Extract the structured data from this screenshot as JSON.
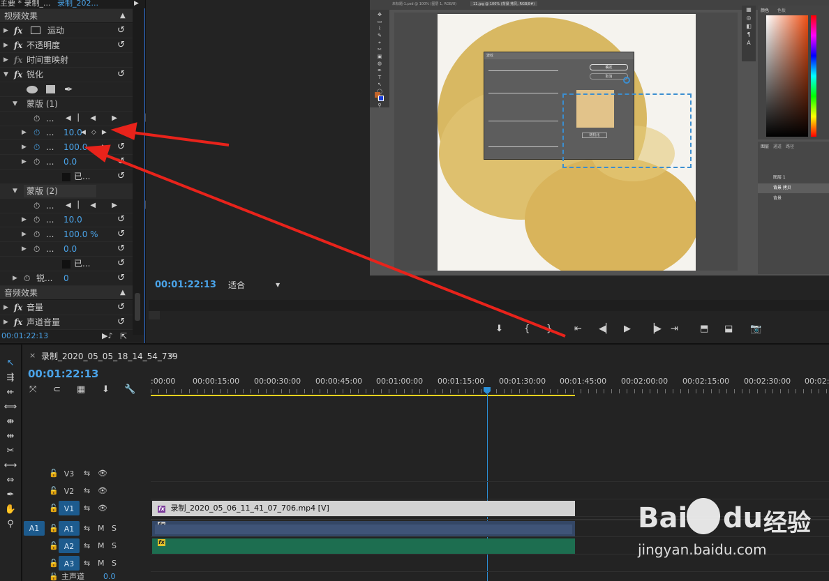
{
  "effect_controls": {
    "header": [
      "主要 * 录制_...",
      "录制_202..."
    ],
    "video_effects": "视频效果",
    "motion": "运动",
    "opacity": "不透明度",
    "time_remap": "时间重映射",
    "sharpen": "锐化",
    "mask1": "蒙版 (1)",
    "mask2": "蒙版 (2)",
    "ellipsis": "...",
    "mask1_values": [
      "10.0",
      "100.0",
      "0.0"
    ],
    "mask2_values": [
      "10.0",
      "100.0 %",
      "0.0"
    ],
    "inverted": "已...",
    "sharpen_param": "锐...",
    "sharpen_value": "0",
    "audio_effects": "音频效果",
    "volume": "音量",
    "channel_volume": "声道音量",
    "timecode": "00:01:22:13"
  },
  "program_monitor": {
    "timecode": "00:01:22:13",
    "fit": "适合"
  },
  "photoshop": {
    "tabs": [
      "未标题-1.psd @ 100% (图层 1, RGB/8)",
      "11.jpg @ 100% (背景 拷贝, RGB/8#)"
    ],
    "dialog_title": "波纹",
    "ok": "确定",
    "cancel": "取消",
    "randomize": "随机化",
    "panel_tabs": [
      "颜色",
      "色板"
    ],
    "layer_tabs": [
      "图层",
      "通道",
      "路径"
    ],
    "layers": [
      "图层 1",
      "背景 拷贝",
      "背景"
    ]
  },
  "timeline": {
    "sequence_name": "录制_2020_05_05_18_14_54_739",
    "timecode": "00:01:22:13",
    "ruler": [
      ":00:00",
      "00:00:15:00",
      "00:00:30:00",
      "00:00:45:00",
      "00:01:00:00",
      "00:01:15:00",
      "00:01:30:00",
      "00:01:45:00",
      "00:02:00:00",
      "00:02:15:00",
      "00:02:30:00",
      "00:02:4"
    ],
    "tracks": {
      "v3": "V3",
      "v2": "V2",
      "v1": "V1",
      "a1src": "A1",
      "a1": "A1",
      "a2": "A2",
      "a3": "A3",
      "m": "M",
      "s": "S"
    },
    "master": "主声道",
    "master_value": "0.0",
    "video_clip": "录制_2020_05_06_11_41_07_706.mp4 [V]",
    "fx": "fx"
  },
  "watermark": {
    "brand": "Bai",
    "brand2": "du",
    "cn": "经验",
    "url": "jingyan.baidu.com"
  },
  "colors": {
    "accent": "#4aa3e8",
    "arrow": "#e8231b",
    "video_clip": "#d2d2d2",
    "a1_clip": "#344766",
    "a2_clip": "#1d6e50",
    "playhead": "#2b8fd6"
  }
}
